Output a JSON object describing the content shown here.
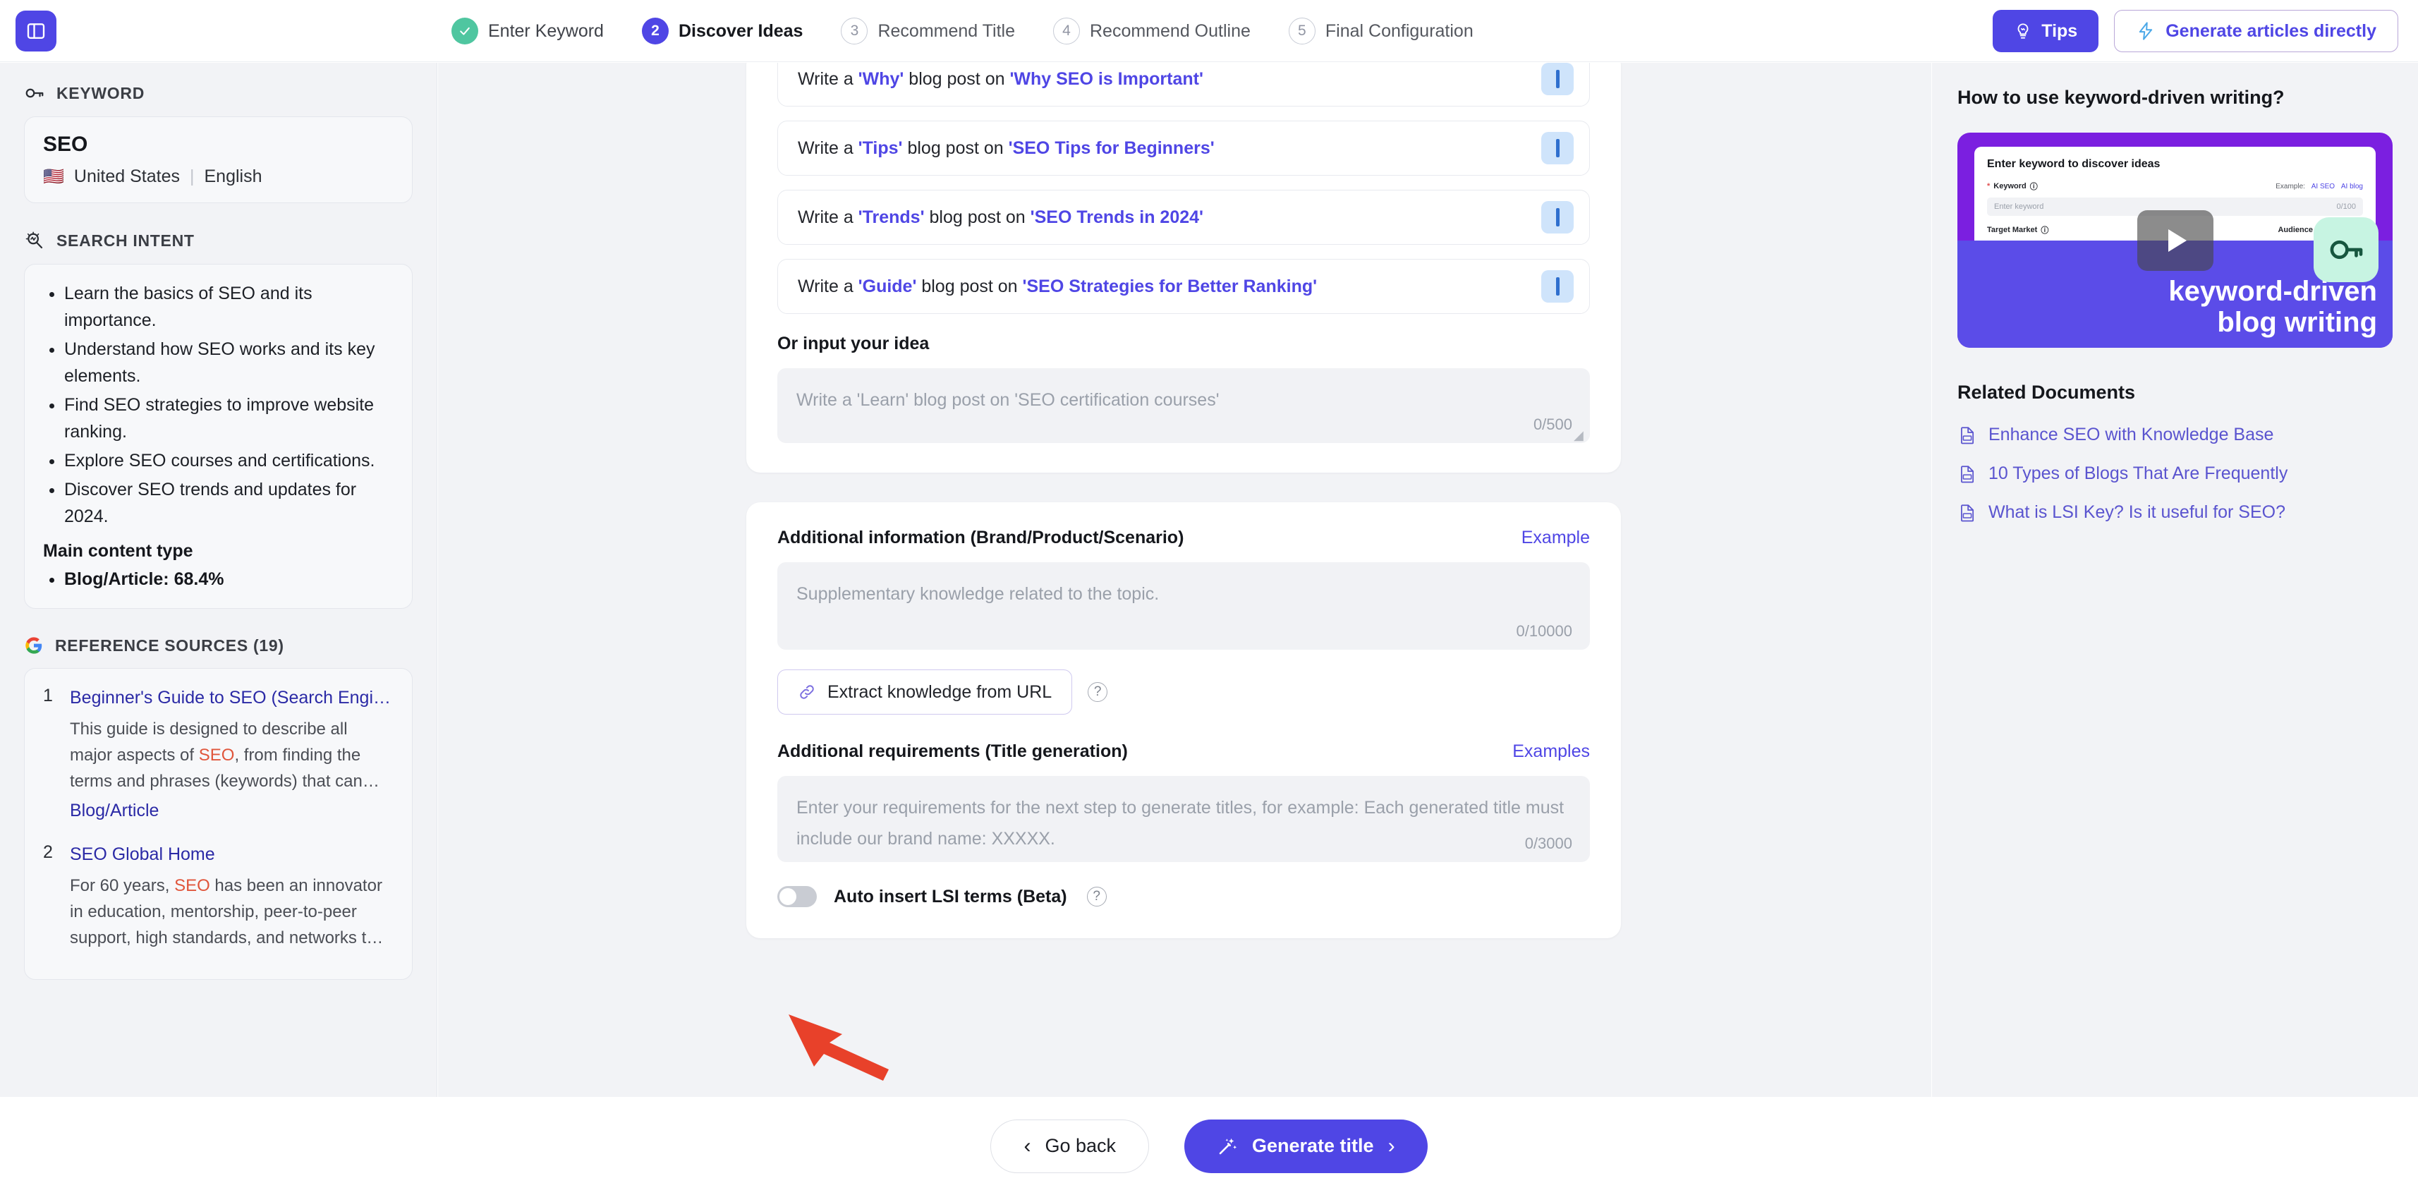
{
  "topbar": {
    "sidebar_toggle_name": "panel-left-icon",
    "steps": [
      {
        "num": "1",
        "label": "Enter Keyword",
        "state": "done"
      },
      {
        "num": "2",
        "label": "Discover Ideas",
        "state": "active"
      },
      {
        "num": "3",
        "label": "Recommend Title",
        "state": "todo"
      },
      {
        "num": "4",
        "label": "Recommend Outline",
        "state": "todo"
      },
      {
        "num": "5",
        "label": "Final Configuration",
        "state": "todo"
      }
    ],
    "tips_label": "Tips",
    "generate_direct_label": "Generate articles directly"
  },
  "sidebar": {
    "keyword_section_title": "KEYWORD",
    "keyword": "SEO",
    "country": "United States",
    "country_flag": "🇺🇸",
    "language": "English",
    "search_intent_title": "SEARCH INTENT",
    "search_intent": [
      "Learn the basics of SEO and its importance.",
      "Understand how SEO works and its key elements.",
      "Find SEO strategies to improve website ranking.",
      "Explore SEO courses and certifications.",
      "Discover SEO trends and updates for 2024."
    ],
    "main_content_type_title": "Main content type",
    "main_content_type": [
      "Blog/Article: 68.4%"
    ],
    "reference_title": "REFERENCE SOURCES (19)",
    "references": [
      {
        "num": "1",
        "title": "Beginner's Guide to SEO (Search Engi…",
        "desc_pre": "This guide is designed to describe all major aspects of ",
        "desc_hl": "SEO",
        "desc_post": ", from finding the terms and phrases (keywords) that can…",
        "tag": "Blog/Article"
      },
      {
        "num": "2",
        "title": "SEO Global Home",
        "desc_pre": "For 60 years, ",
        "desc_hl": "SEO",
        "desc_post": " has been an innovator in education, mentorship, peer-to-peer support, high standards, and networks t…",
        "tag": ""
      }
    ]
  },
  "main": {
    "ideas": [
      {
        "pre": "Write a ",
        "type": "'Why'",
        "mid": " blog post on ",
        "topic": "'Why SEO is Important'"
      },
      {
        "pre": "Write a ",
        "type": "'Tips'",
        "mid": " blog post on ",
        "topic": "'SEO Tips for Beginners'"
      },
      {
        "pre": "Write a ",
        "type": "'Trends'",
        "mid": " blog post on ",
        "topic": "'SEO Trends in 2024'"
      },
      {
        "pre": "Write a ",
        "type": "'Guide'",
        "mid": " blog post on ",
        "topic": "'SEO Strategies for Better Ranking'"
      }
    ],
    "idea_badge_label": "I",
    "own_idea_label": "Or input your idea",
    "own_idea_placeholder": "Write a 'Learn' blog post on 'SEO certification courses'",
    "own_idea_counter": "0/500",
    "additional_info_label": "Additional information (Brand/Product/Scenario)",
    "additional_info_link": "Example",
    "additional_info_placeholder": "Supplementary knowledge related to the topic.",
    "additional_info_counter": "0/10000",
    "extract_url_label": "Extract knowledge from URL",
    "additional_req_label": "Additional requirements (Title generation)",
    "additional_req_link": "Examples",
    "additional_req_placeholder": "Enter your requirements for the next step to generate titles, for example: Each generated title must include our brand name: XXXXX.",
    "additional_req_counter": "0/3000",
    "lsi_toggle_label": "Auto insert LSI terms (Beta)",
    "lsi_toggle_state": "off"
  },
  "rightpanel": {
    "title": "How to use keyword-driven writing?",
    "video": {
      "heading": "Enter keyword to discover ideas",
      "keyword_label": "Keyword",
      "example_label": "Example:",
      "example_links": [
        "AI SEO",
        "AI blog"
      ],
      "input_placeholder": "Enter keyword",
      "input_counter": "0/100",
      "target_market_label": "Target Market",
      "audience_language_label": "Audience Language",
      "overlay_line1": "keyword-driven",
      "overlay_line2": "blog writing"
    },
    "related_documents_title": "Related Documents",
    "related_documents": [
      "Enhance SEO with Knowledge Base",
      "10 Types of Blogs That Are Frequently",
      "What is LSI Key? Is it useful for SEO?"
    ]
  },
  "bottombar": {
    "back_label": "Go back",
    "generate_label": "Generate title"
  },
  "colors": {
    "accent": "#4f46e5",
    "success": "#4fc6a0",
    "annotation": "#e8412a",
    "badge_bg": "#cfe4fb",
    "link": "#2b2aa6"
  }
}
